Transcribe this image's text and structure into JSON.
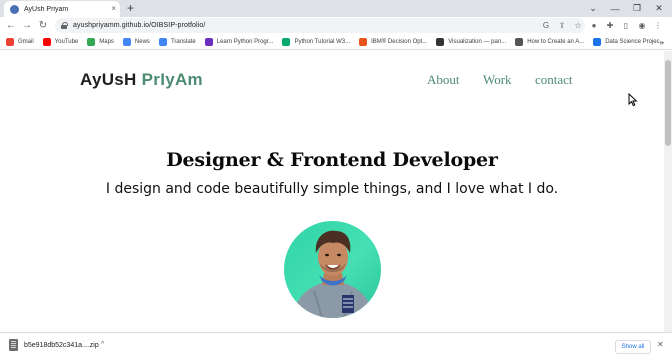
{
  "browser": {
    "tab_title": "AyUsh Priyam",
    "tab_close": "×",
    "new_tab": "+",
    "window_controls": [
      "⌄",
      "—",
      "❐",
      "✕"
    ],
    "url": "ayushpriyamm.github.io/OIBSIP-protfolio/",
    "nav": {
      "back": "←",
      "forward": "→",
      "reload": "↻"
    },
    "toolbar_icons": [
      "google-lens-icon",
      "share-icon",
      "star-icon",
      "extension-icon",
      "puzzle-icon",
      "sidepanel-icon",
      "profile-icon",
      "menu-icon"
    ],
    "bookmarks": [
      {
        "label": "Gmail",
        "color": "#ea4335"
      },
      {
        "label": "YouTube",
        "color": "#ff0000"
      },
      {
        "label": "Maps",
        "color": "#34a853"
      },
      {
        "label": "News",
        "color": "#4285f4"
      },
      {
        "label": "Translate",
        "color": "#4285f4"
      },
      {
        "label": "Learn Python Progr...",
        "color": "#6b2fbf"
      },
      {
        "label": "Python Tutorial W3...",
        "color": "#04aa6d"
      },
      {
        "label": "IBM® Decision Opt...",
        "color": "#e8541c"
      },
      {
        "label": "Visualization — pan...",
        "color": "#333333"
      },
      {
        "label": "How to Create an A...",
        "color": "#555555"
      },
      {
        "label": "Data Science Projec...",
        "color": "#1a73e8"
      }
    ],
    "bookmarks_more": "»"
  },
  "page": {
    "brand_part1": "AyUsH",
    "brand_part2": "PrIyAm",
    "nav": [
      "About",
      "Work",
      "contact"
    ],
    "headline": "Designer & Frontend Developer",
    "tagline": "I design and code beautifully simple things, and I love what I do.",
    "accent_color": "#4d8c72"
  },
  "downloads": {
    "file_name": "b5e918db52c341a....zip",
    "caret": "^",
    "show_all": "Show all",
    "close": "✕"
  }
}
